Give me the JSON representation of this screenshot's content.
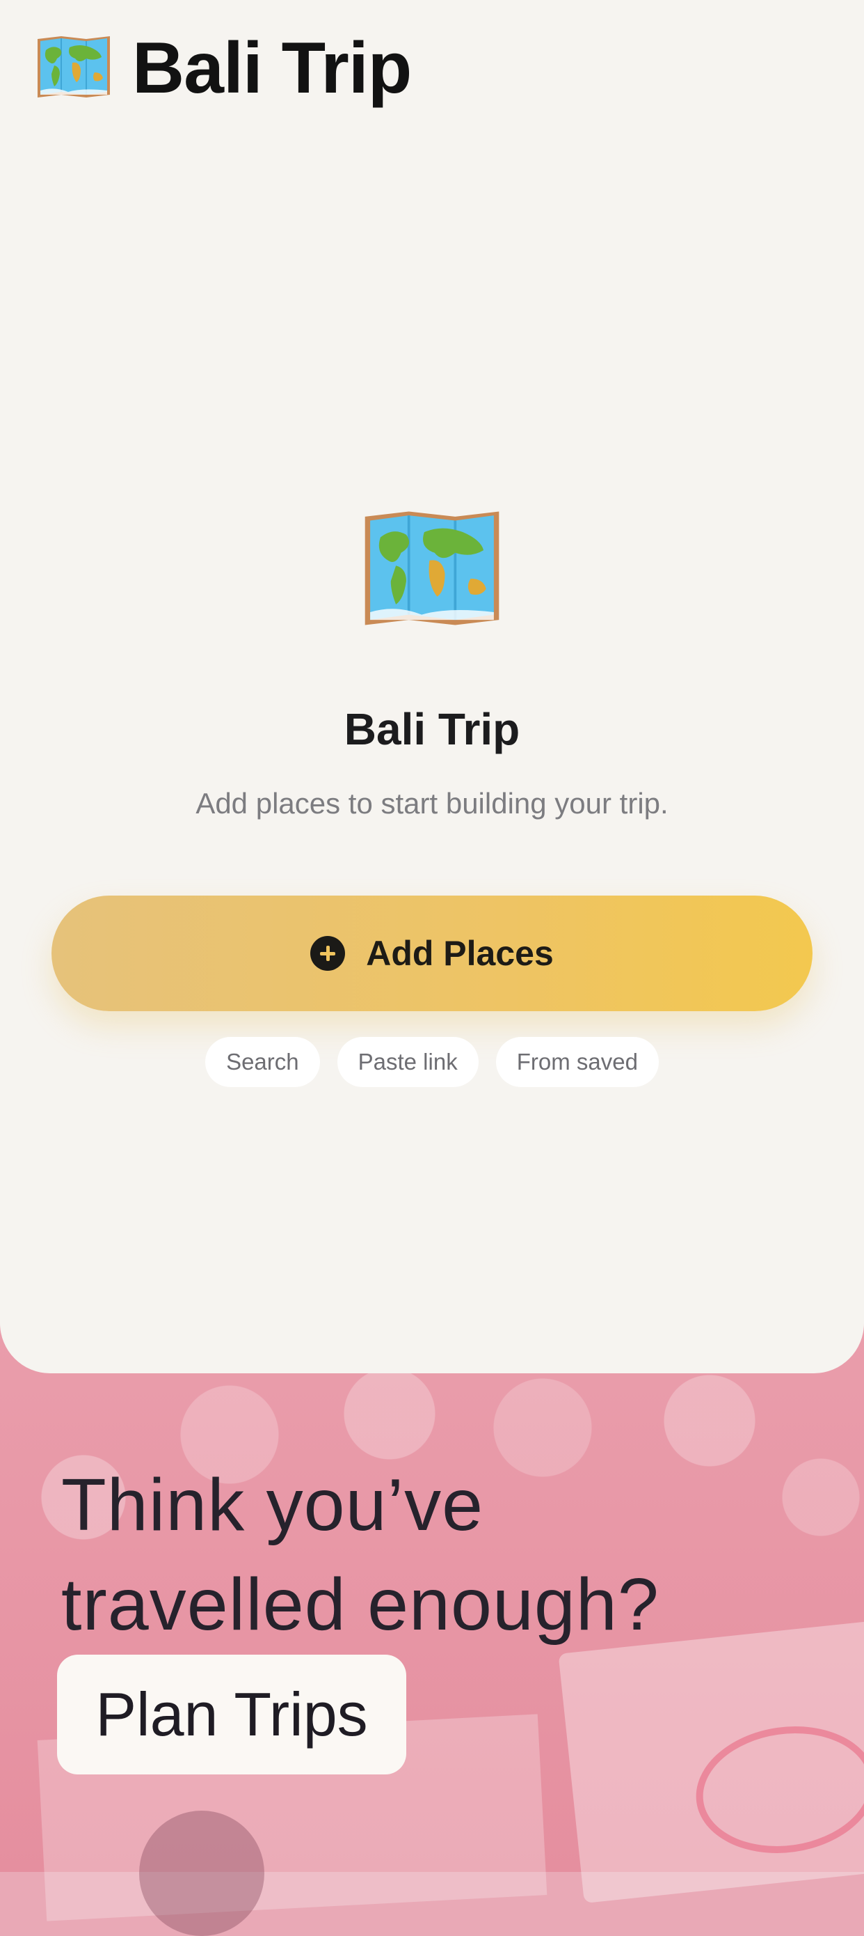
{
  "header": {
    "title": "Bali Trip",
    "icon": "world-map-icon"
  },
  "empty_state": {
    "icon": "world-map-icon",
    "title": "Bali Trip",
    "subtitle": "Add places to start building your trip."
  },
  "actions": {
    "add_places_label": "Add Places",
    "add_icon": "plus-circle-icon",
    "chips": [
      "Search",
      "Paste link",
      "From saved"
    ]
  },
  "promo": {
    "line1": "Think you’ve",
    "line2": "travelled enough?",
    "button_label": "Plan Trips"
  },
  "colors": {
    "sheet_background": "#f6f4f0",
    "accent_gradient_start": "#e6c27a",
    "accent_gradient_end": "#f3c84f",
    "text_primary": "#1c1c1e",
    "text_secondary": "#7c7c80"
  }
}
